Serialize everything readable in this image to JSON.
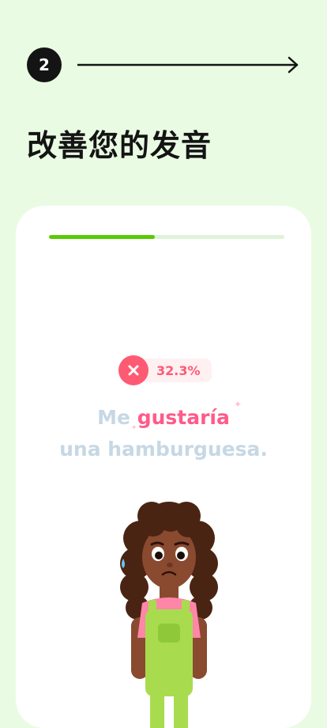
{
  "step": {
    "number": "2"
  },
  "headline": "改善您的发音",
  "lesson": {
    "progress": 0.45,
    "score": {
      "value": "32.3%",
      "status": "incorrect"
    },
    "sentence": {
      "line1_plain": "Me ",
      "line1_highlight": "gustaría",
      "line2": "una hamburguesa."
    }
  },
  "colors": {
    "background": "#eafbe3",
    "accent_green": "#58cc02",
    "error_red": "#ff5a73",
    "highlight_pink": "#ff5a8a",
    "muted_text": "#c6d8e5"
  },
  "icons": {
    "arrow": "long-right-arrow-icon",
    "score": "x-mark-icon",
    "character": "character-illustration"
  }
}
